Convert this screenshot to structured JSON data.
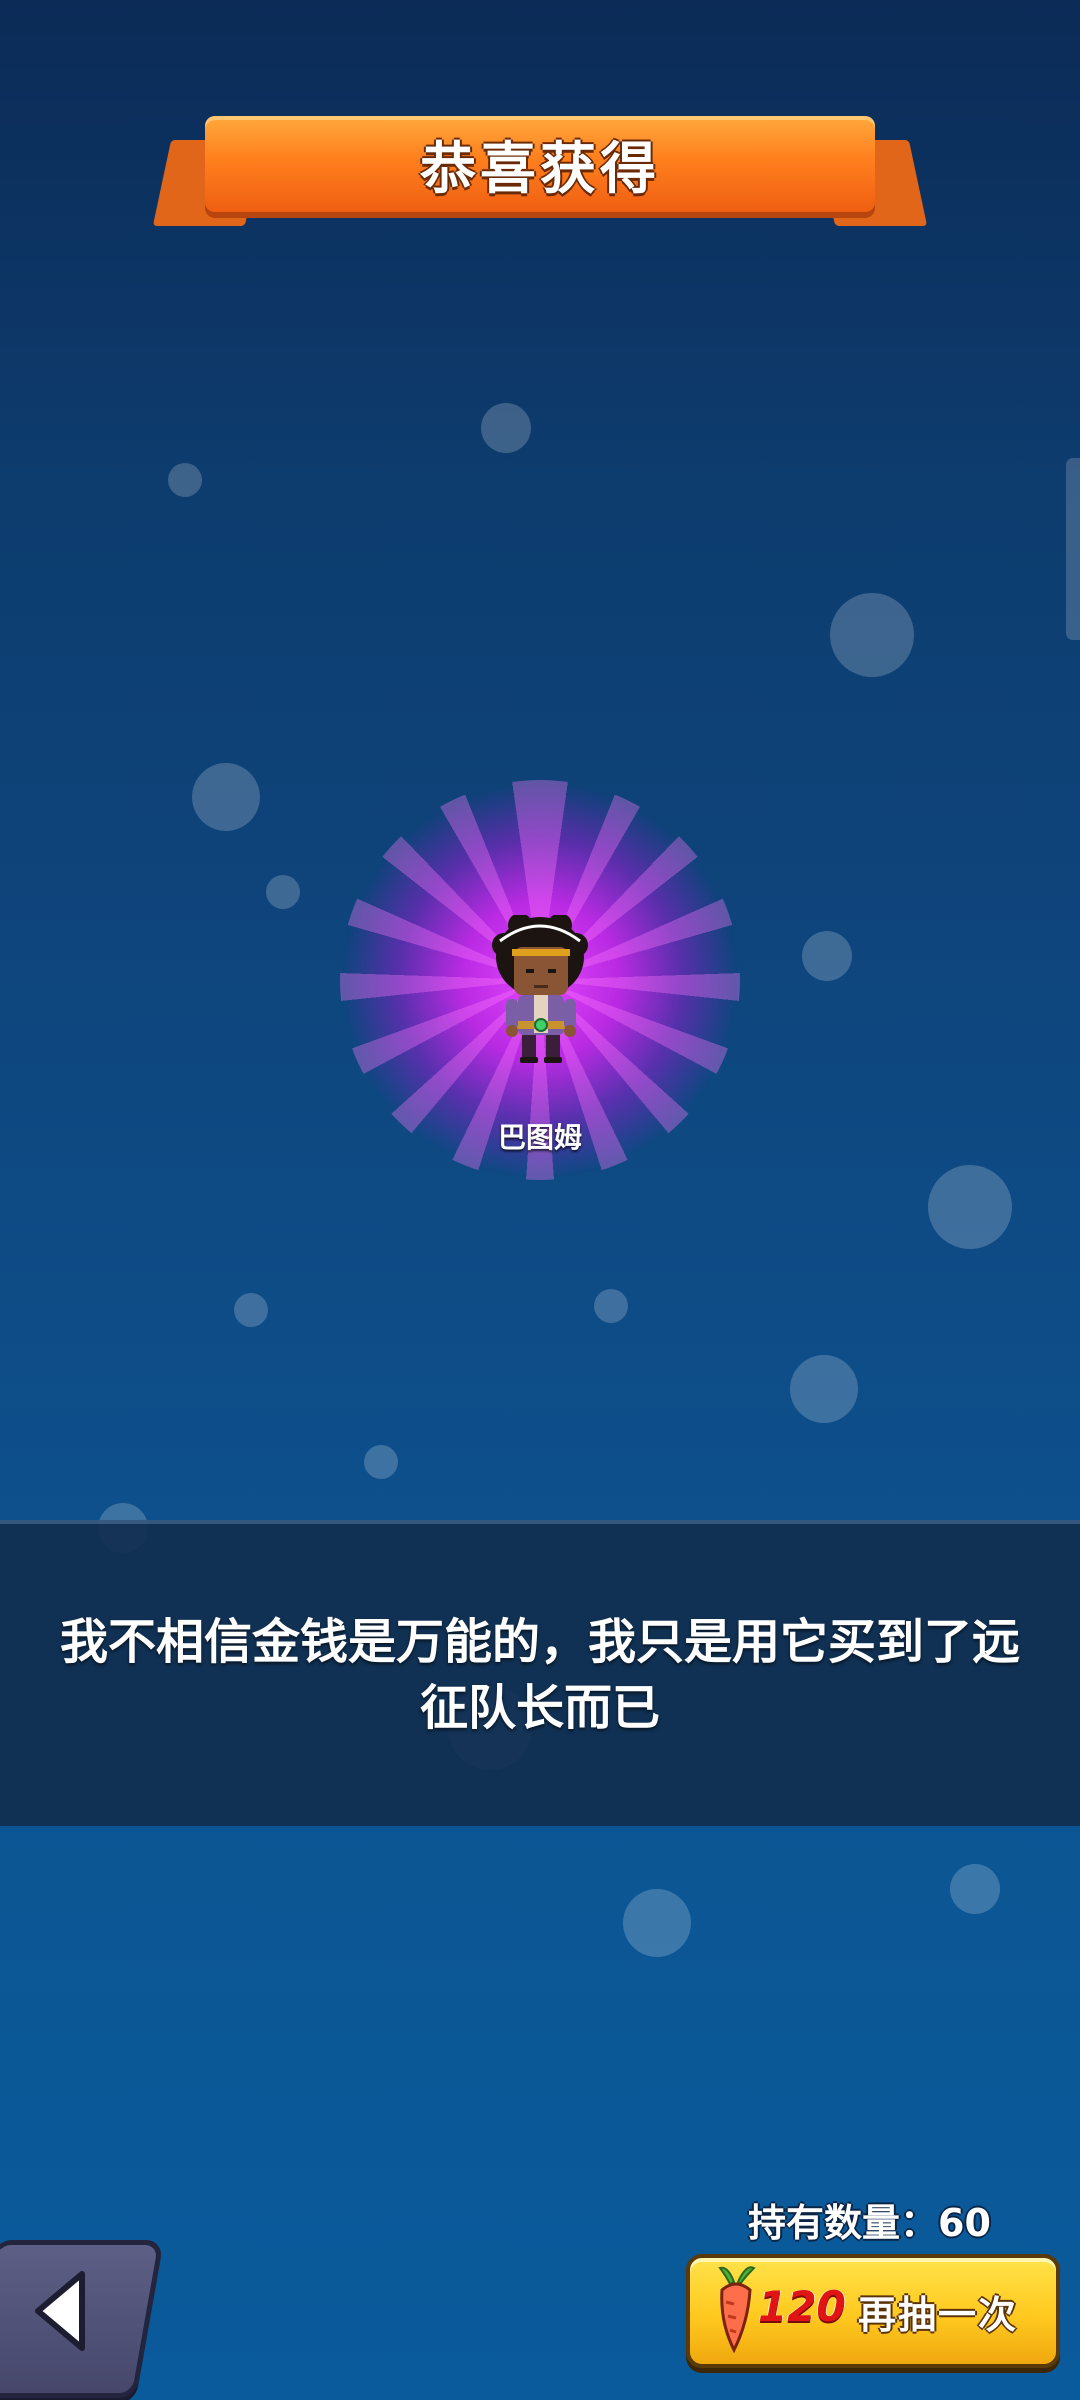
{
  "title": "恭喜获得",
  "reward": {
    "character_name": "巴图姆",
    "quote": "我不相信金钱是万能的，我只是用它买到了远征队长而已",
    "rarity_glow_color": "#d23cf5"
  },
  "inventory": {
    "owned_label": "持有数量：60"
  },
  "actions": {
    "back_icon": "back-arrow-icon",
    "draw_cost": "120",
    "draw_cost_icon": "carrot-icon",
    "draw_again_label": "再抽一次"
  },
  "colors": {
    "ribbon": "#ff7f1d",
    "button_yellow": "#ffc91f",
    "cost_red": "#e01414",
    "back_button": "#4f5177"
  }
}
